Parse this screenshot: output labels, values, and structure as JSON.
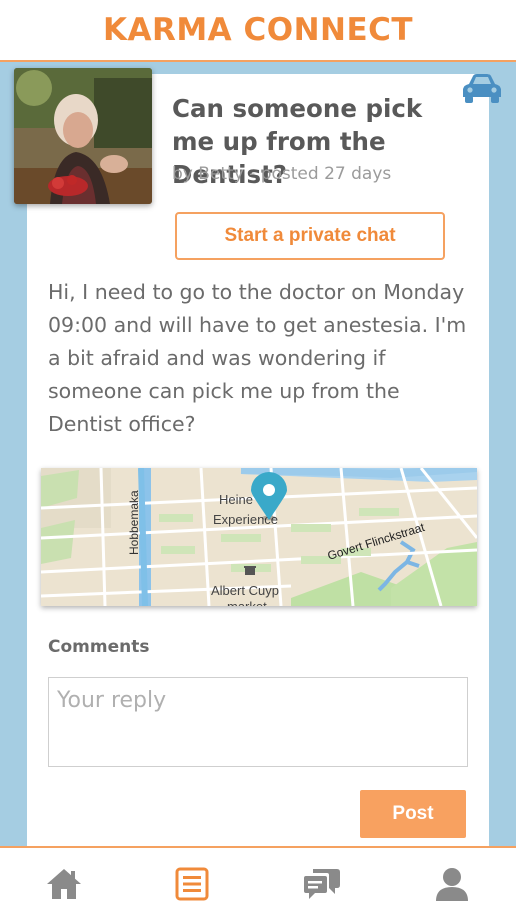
{
  "app": {
    "title": "KARMA CONNECT"
  },
  "colors": {
    "accent": "#f08a3a",
    "background_band": "#a5cde2",
    "car_icon": "#4a8fc2",
    "nav_inactive": "#8a8a8a"
  },
  "post": {
    "title": "Can someone pick me up from the Dentist?",
    "meta": "by Betty - posted 27 days",
    "category_icon": "car-icon",
    "chat_button_label": "Start a private chat",
    "body": "Hi, I need to go to the doctor on Monday 09:00 and will have to get anestesia. I'm a bit afraid and was wondering if someone can pick me up from the Dentist office?"
  },
  "map": {
    "labels": {
      "hobbemaka": "Hobbemaka",
      "heineken_line1": "Heine",
      "heineken_line2": "Experience",
      "govert": "Govert Flinckstraat",
      "albert_line1": "Albert Cuyp",
      "albert_line2": "market"
    },
    "marker_icon": "map-pin-icon"
  },
  "comments": {
    "label": "Comments",
    "placeholder": "Your reply",
    "post_button_label": "Post"
  },
  "nav": {
    "items": [
      {
        "name": "home",
        "icon": "home-icon",
        "active": false
      },
      {
        "name": "posts",
        "icon": "list-icon",
        "active": true
      },
      {
        "name": "chats",
        "icon": "chat-icon",
        "active": false
      },
      {
        "name": "profile",
        "icon": "user-icon",
        "active": false
      }
    ]
  }
}
